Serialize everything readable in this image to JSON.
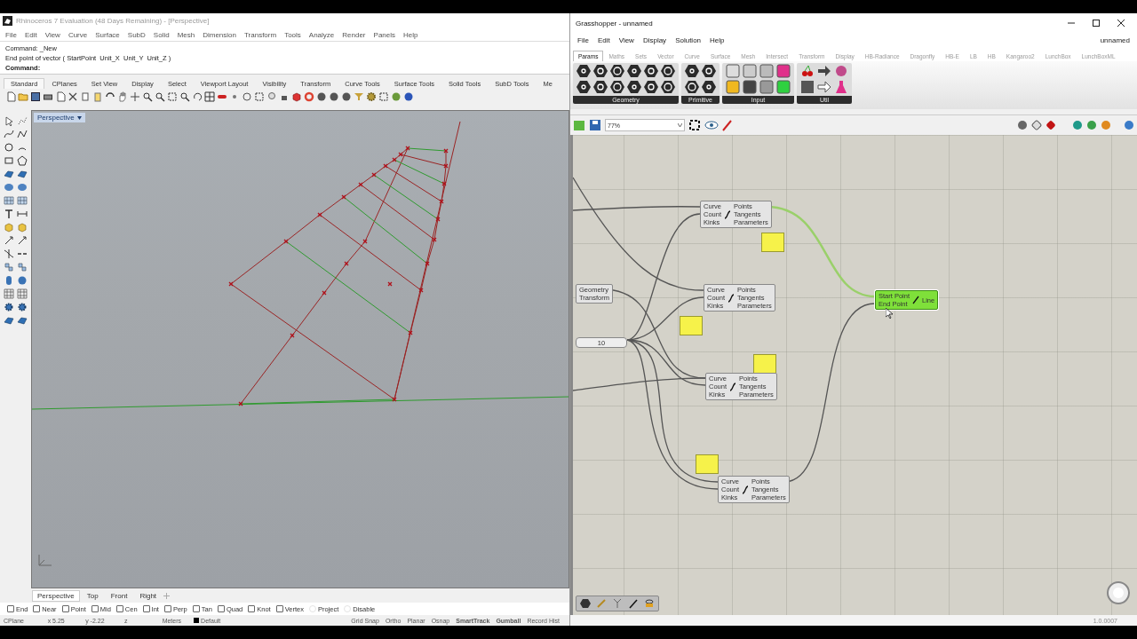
{
  "rhino": {
    "title": "Rhinoceros 7 Evaluation (48 Days Remaining) - [Perspective]",
    "menu": [
      "File",
      "Edit",
      "View",
      "Curve",
      "Surface",
      "SubD",
      "Solid",
      "Mesh",
      "Dimension",
      "Transform",
      "Tools",
      "Analyze",
      "Render",
      "Panels",
      "Help"
    ],
    "command_history": [
      "Command: _New",
      "End point of vector ( StartPoint  Unit_X  Unit_Y  Unit_Z )"
    ],
    "command_prompt": "Command:",
    "toolbar_tabs": [
      {
        "label": "Standard",
        "selected": true
      },
      {
        "label": "CPlanes",
        "selected": false
      },
      {
        "label": "Set View",
        "selected": false
      },
      {
        "label": "Display",
        "selected": false
      },
      {
        "label": "Select",
        "selected": false
      },
      {
        "label": "Viewport Layout",
        "selected": false
      },
      {
        "label": "Visibility",
        "selected": false
      },
      {
        "label": "Transform",
        "selected": false
      },
      {
        "label": "Curve Tools",
        "selected": false
      },
      {
        "label": "Surface Tools",
        "selected": false
      },
      {
        "label": "Solid Tools",
        "selected": false
      },
      {
        "label": "SubD Tools",
        "selected": false
      },
      {
        "label": "Me",
        "selected": false
      }
    ],
    "viewport": {
      "title": "Perspective"
    },
    "viewport_tabs": [
      {
        "label": "Perspective",
        "selected": true
      },
      {
        "label": "Top",
        "selected": false
      },
      {
        "label": "Front",
        "selected": false
      },
      {
        "label": "Right",
        "selected": false
      }
    ],
    "osnaps": [
      {
        "label": "End",
        "checked": false,
        "kind": "checkbox"
      },
      {
        "label": "Near",
        "checked": false,
        "kind": "checkbox"
      },
      {
        "label": "Point",
        "checked": false,
        "kind": "checkbox"
      },
      {
        "label": "Mid",
        "checked": false,
        "kind": "checkbox"
      },
      {
        "label": "Cen",
        "checked": false,
        "kind": "checkbox"
      },
      {
        "label": "Int",
        "checked": false,
        "kind": "checkbox"
      },
      {
        "label": "Perp",
        "checked": false,
        "kind": "checkbox"
      },
      {
        "label": "Tan",
        "checked": false,
        "kind": "checkbox"
      },
      {
        "label": "Quad",
        "checked": false,
        "kind": "checkbox"
      },
      {
        "label": "Knot",
        "checked": false,
        "kind": "checkbox"
      },
      {
        "label": "Vertex",
        "checked": false,
        "kind": "checkbox"
      },
      {
        "label": "Project",
        "checked": false,
        "kind": "radio"
      },
      {
        "label": "Disable",
        "checked": false,
        "kind": "radio"
      }
    ],
    "status": [
      {
        "label": "CPlane",
        "kind": "field"
      },
      {
        "label": "x 5.25",
        "kind": "field"
      },
      {
        "label": "y -2.22",
        "kind": "field"
      },
      {
        "label": "z",
        "kind": "field"
      },
      {
        "label": "Meters",
        "kind": "field"
      },
      {
        "label": "Default",
        "kind": "layer"
      },
      {
        "label": "Grid Snap",
        "kind": "toggle",
        "on": false
      },
      {
        "label": "Ortho",
        "kind": "toggle",
        "on": false
      },
      {
        "label": "Planar",
        "kind": "toggle",
        "on": false
      },
      {
        "label": "Osnap",
        "kind": "toggle",
        "on": false
      },
      {
        "label": "SmartTrack",
        "kind": "toggle",
        "on": true
      },
      {
        "label": "Gumball",
        "kind": "toggle",
        "on": true
      },
      {
        "label": "Record Hist",
        "kind": "toggle",
        "on": false
      }
    ]
  },
  "grasshopper": {
    "title": "Grasshopper - unnamed",
    "menu": [
      "File",
      "Edit",
      "View",
      "Display",
      "Solution",
      "Help"
    ],
    "document_name": "unnamed",
    "tabs": [
      {
        "label": "Params",
        "selected": true
      },
      {
        "label": "Maths",
        "selected": false
      },
      {
        "label": "Sets",
        "selected": false
      },
      {
        "label": "Vector",
        "selected": false
      },
      {
        "label": "Curve",
        "selected": false
      },
      {
        "label": "Surface",
        "selected": false
      },
      {
        "label": "Mesh",
        "selected": false
      },
      {
        "label": "Intersect",
        "selected": false
      },
      {
        "label": "Transform",
        "selected": false
      },
      {
        "label": "Display",
        "selected": false
      },
      {
        "label": "HB-Radiance",
        "selected": false
      },
      {
        "label": "Dragonfly",
        "selected": false
      },
      {
        "label": "HB-E",
        "selected": false
      },
      {
        "label": "LB",
        "selected": false
      },
      {
        "label": "HB",
        "selected": false
      },
      {
        "label": "Kangaroo2",
        "selected": false
      },
      {
        "label": "LunchBox",
        "selected": false
      },
      {
        "label": "LunchBoxML",
        "selected": false
      }
    ],
    "ribbon_groups": [
      {
        "label": "Geometry"
      },
      {
        "label": "Primitive"
      },
      {
        "label": "Input"
      },
      {
        "label": "Util"
      }
    ],
    "zoom": "77%",
    "components": [
      {
        "kind": "divide",
        "selected": false,
        "inputs": [
          "Curve",
          "Count",
          "Kinks"
        ],
        "outputs": [
          "Points",
          "Tangents",
          "Parameters"
        ]
      },
      {
        "kind": "panel",
        "selected": false
      },
      {
        "kind": "param",
        "selected": false,
        "inputs": [
          "Geometry",
          "Transform"
        ]
      },
      {
        "kind": "divide",
        "selected": false,
        "inputs": [
          "Curve",
          "Count",
          "Kinks"
        ],
        "outputs": [
          "Points",
          "Tangents",
          "Parameters"
        ]
      },
      {
        "kind": "panel",
        "selected": false
      },
      {
        "kind": "slider",
        "selected": false,
        "value": "10"
      },
      {
        "kind": "panel",
        "selected": false
      },
      {
        "kind": "divide",
        "selected": false,
        "inputs": [
          "Curve",
          "Count",
          "Kinks"
        ],
        "outputs": [
          "Points",
          "Tangents",
          "Parameters"
        ]
      },
      {
        "kind": "panel",
        "selected": false
      },
      {
        "kind": "divide",
        "selected": false,
        "inputs": [
          "Curve",
          "Count",
          "Kinks"
        ],
        "outputs": [
          "Points",
          "Tangents",
          "Parameters"
        ]
      },
      {
        "kind": "line",
        "selected": true,
        "inputs": [
          "Start Point",
          "End Point"
        ],
        "outputs": [
          "Line"
        ]
      }
    ],
    "version": "1.0.0007"
  }
}
